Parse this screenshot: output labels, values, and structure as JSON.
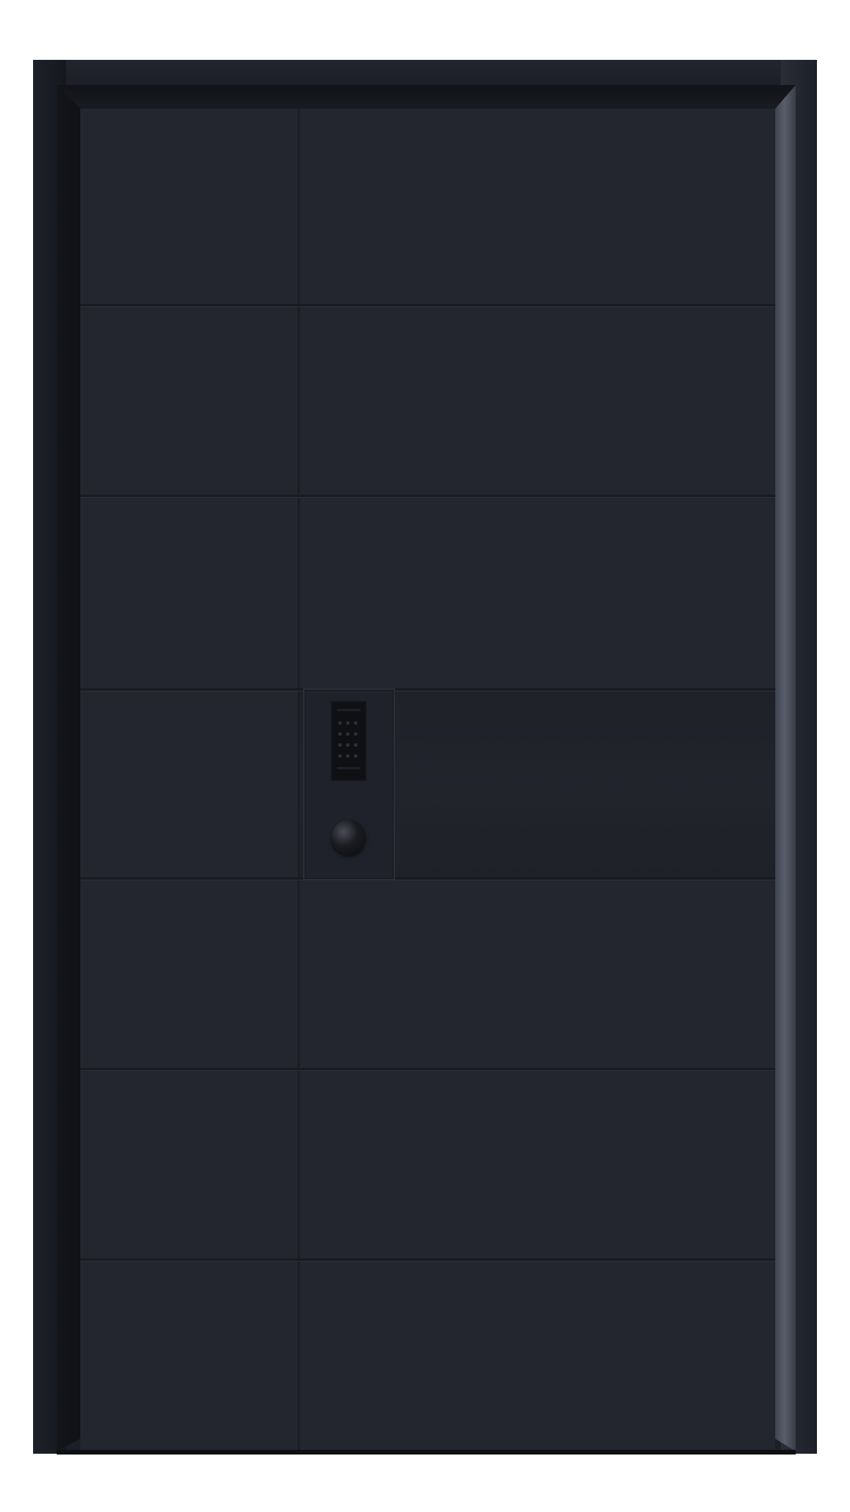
{
  "scene": {
    "subject": "door-photo",
    "colors": {
      "background": "#ffffff",
      "door": "#23252f",
      "frame": "#1c1f27",
      "frame_highlight": "#5a5d6b",
      "lock_keypad": "#0f1013"
    },
    "icons": [
      "keypad-icon",
      "knob-icon"
    ]
  }
}
